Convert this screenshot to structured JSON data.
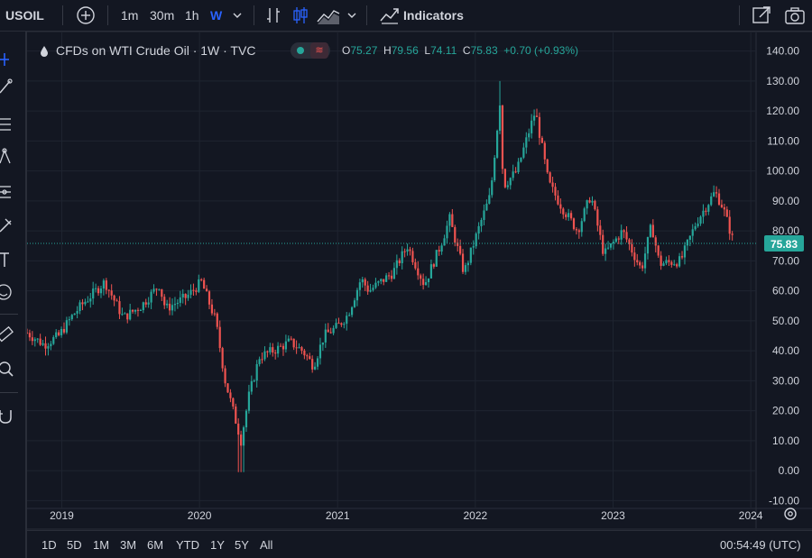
{
  "toolbar": {
    "symbol": "USOIL",
    "intervals": [
      "1m",
      "30m",
      "1h",
      "W"
    ],
    "active_interval": "W",
    "indicators_label": "Indicators"
  },
  "legend": {
    "title": "CFDs on WTI Crude Oil · 1W · TVC",
    "ohlc": {
      "o_label": "O",
      "o": "75.27",
      "h_label": "H",
      "h": "79.56",
      "l_label": "L",
      "l": "74.11",
      "c_label": "C",
      "c": "75.83",
      "change": "+0.70 (+0.93%)"
    }
  },
  "bottombar": {
    "ranges": [
      "1D",
      "5D",
      "1M",
      "3M",
      "6M",
      "YTD",
      "1Y",
      "5Y",
      "All"
    ],
    "clock": "00:54:49 (UTC)"
  },
  "colors": {
    "up": "#26a69a",
    "down": "#ef5350",
    "background": "#131722",
    "grid": "#2a2e39",
    "accent": "#2962ff",
    "price_label": "#26a69a"
  },
  "chart_data": {
    "type": "candlestick",
    "timeframe": "1W",
    "y_ticks": [
      "140.00",
      "130.00",
      "120.00",
      "110.00",
      "100.00",
      "90.00",
      "80.00",
      "70.00",
      "60.00",
      "50.00",
      "40.00",
      "30.00",
      "20.00",
      "10.00",
      "0.00",
      "-10.00"
    ],
    "x_ticks": [
      "2019",
      "2020",
      "2021",
      "2022",
      "2023",
      "2024"
    ],
    "ylim": [
      -12,
      145
    ],
    "xlim": [
      "2018-10-01",
      "2024-01-15"
    ],
    "last_price": "75.83",
    "grid": true,
    "series": [
      {
        "values": [
          [
            "2018-10-01",
            62,
            46
          ],
          [
            "2018-11-15",
            58,
            42
          ],
          [
            "2018-12-24",
            48,
            45
          ],
          [
            "2019-01-31",
            55,
            52
          ],
          [
            "2019-02-28",
            58,
            56
          ],
          [
            "2019-04-25",
            66,
            63
          ],
          [
            "2019-06-13",
            52,
            51
          ],
          [
            "2019-07-31",
            58,
            55
          ],
          [
            "2019-09-16",
            56,
            62
          ],
          [
            "2019-10-03",
            52,
            54
          ],
          [
            "2019-11-28",
            57,
            58
          ],
          [
            "2020-01-06",
            62,
            63
          ],
          [
            "2020-02-13",
            52,
            50
          ],
          [
            "2020-03-09",
            41,
            30
          ],
          [
            "2020-03-30",
            20,
            20
          ],
          [
            "2020-04-20",
            10,
            10
          ],
          [
            "2020-05-11",
            25,
            25
          ],
          [
            "2020-06-08",
            38,
            38
          ],
          [
            "2020-07-31",
            41,
            41
          ],
          [
            "2020-08-27",
            43,
            43
          ],
          [
            "2020-09-30",
            40,
            40
          ],
          [
            "2020-10-29",
            36,
            35
          ],
          [
            "2020-11-26",
            45,
            45
          ],
          [
            "2020-12-31",
            48,
            48
          ],
          [
            "2021-01-28",
            52,
            52
          ],
          [
            "2021-03-04",
            64,
            64
          ],
          [
            "2021-03-25",
            60,
            60
          ],
          [
            "2021-05-27",
            66,
            66
          ],
          [
            "2021-07-05",
            75,
            75
          ],
          [
            "2021-08-19",
            62,
            62
          ],
          [
            "2021-09-30",
            75,
            75
          ],
          [
            "2021-10-25",
            84,
            84
          ],
          [
            "2021-12-02",
            66,
            66
          ],
          [
            "2022-01-13",
            82,
            82
          ],
          [
            "2022-02-10",
            92,
            92
          ],
          [
            "2022-03-07",
            123,
            123
          ],
          [
            "2022-03-16",
            95,
            95
          ],
          [
            "2022-04-21",
            100,
            100
          ],
          [
            "2022-06-09",
            120,
            120
          ],
          [
            "2022-07-14",
            96,
            96
          ],
          [
            "2022-08-18",
            88,
            88
          ],
          [
            "2022-09-29",
            80,
            80
          ],
          [
            "2022-11-03",
            92,
            92
          ],
          [
            "2022-12-08",
            72,
            72
          ],
          [
            "2023-01-26",
            80,
            80
          ],
          [
            "2023-03-17",
            67,
            67
          ],
          [
            "2023-04-13",
            82,
            82
          ],
          [
            "2023-05-04",
            69,
            69
          ],
          [
            "2023-06-29",
            70,
            70
          ],
          [
            "2023-08-10",
            83,
            83
          ],
          [
            "2023-09-28",
            93,
            93
          ],
          [
            "2023-10-19",
            88,
            88
          ],
          [
            "2023-11-17",
            75.83,
            75.83
          ]
        ]
      }
    ]
  }
}
